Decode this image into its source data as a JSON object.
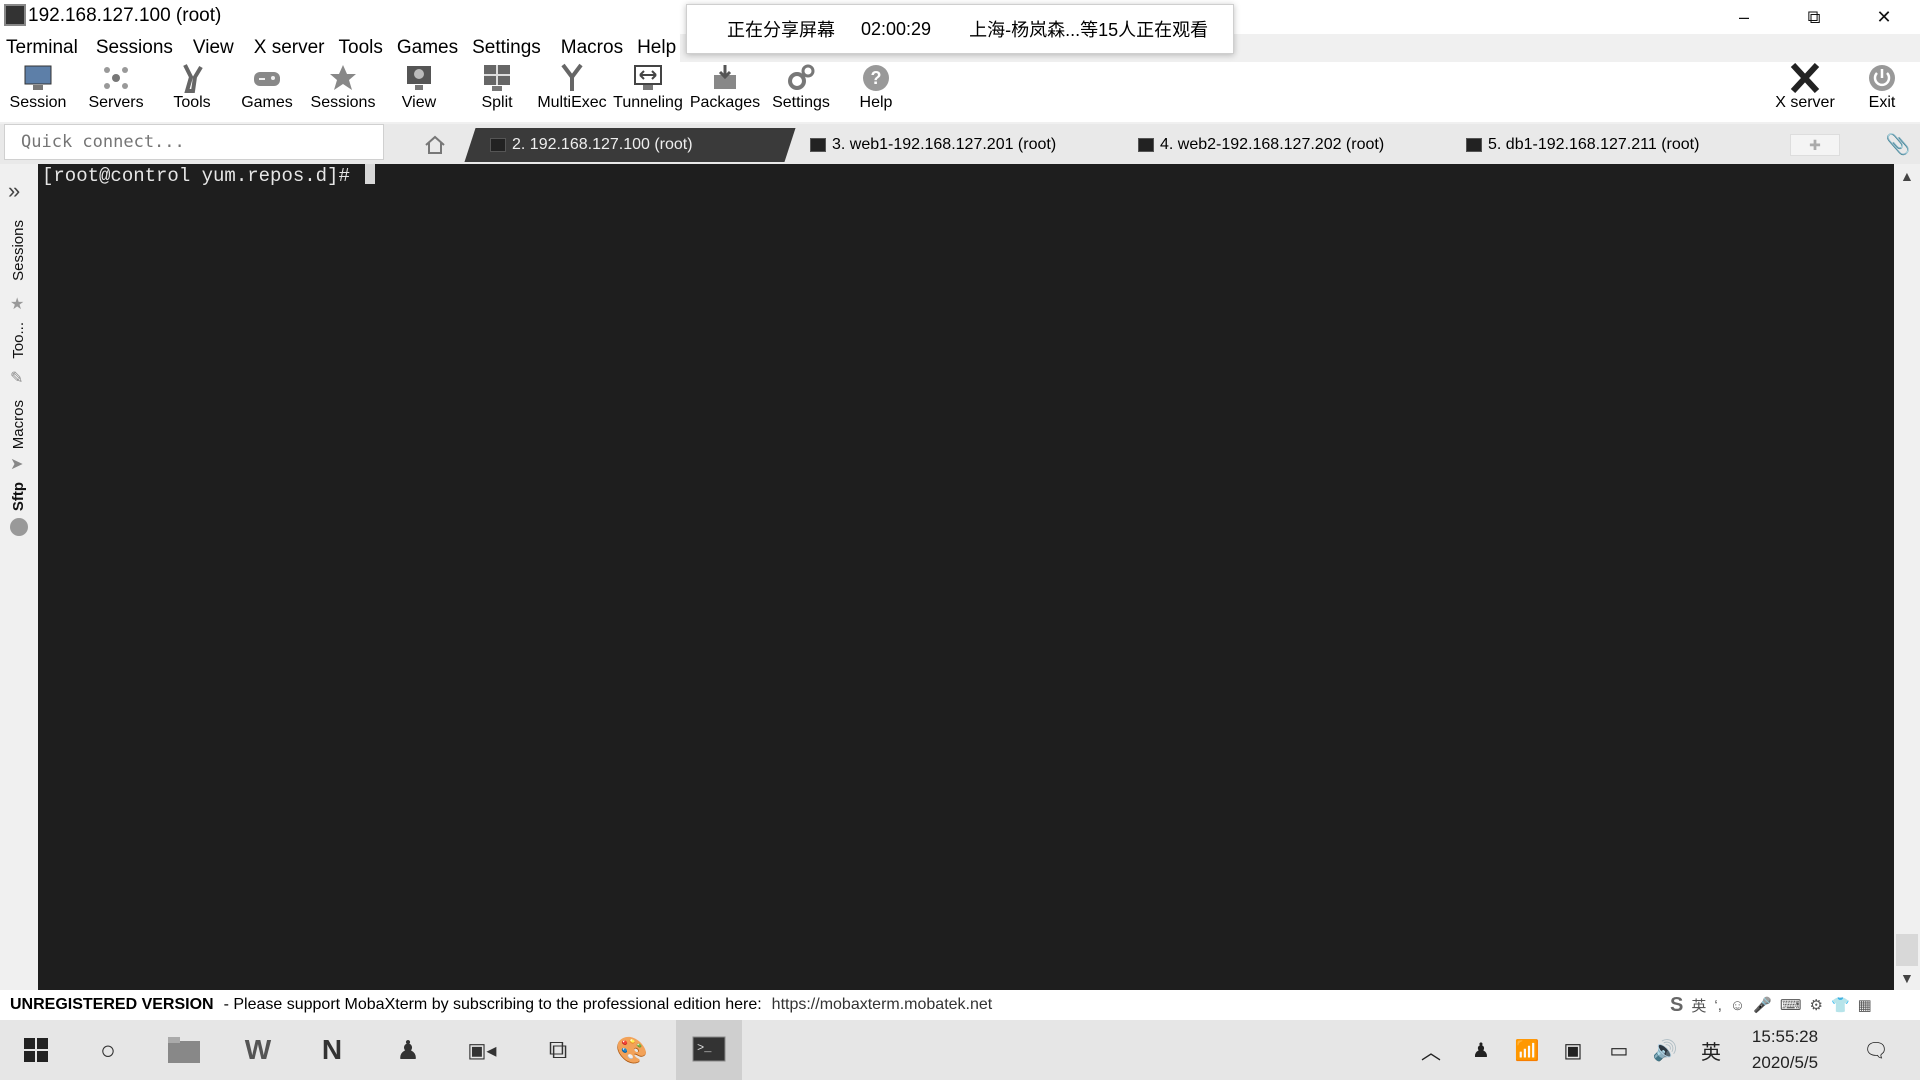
{
  "window": {
    "title": "192.168.127.100 (root)",
    "minimize": "–",
    "restore": "⧉",
    "close": "✕"
  },
  "menu": [
    "Terminal",
    "Sessions",
    "View",
    "X server",
    "Tools",
    "Games",
    "Settings",
    "Macros",
    "Help"
  ],
  "toolbar": {
    "session": "Session",
    "servers": "Servers",
    "tools": "Tools",
    "games": "Games",
    "sessions": "Sessions",
    "view": "View",
    "split": "Split",
    "multiexec": "MultiExec",
    "tunneling": "Tunneling",
    "packages": "Packages",
    "settings": "Settings",
    "help": "Help",
    "xserver": "X server",
    "exit": "Exit"
  },
  "share": {
    "status": "正在分享屏幕",
    "elapsed": "02:00:29",
    "viewers": "上海-杨岚森...等15人正在观看"
  },
  "quick_connect": {
    "placeholder": "Quick connect..."
  },
  "tabs": [
    {
      "label": "2. 192.168.127.100 (root)"
    },
    {
      "label": "3. web1-192.168.127.201 (root)"
    },
    {
      "label": "4. web2-192.168.127.202 (root)"
    },
    {
      "label": "5. db1-192.168.127.211 (root)"
    }
  ],
  "sidebar": {
    "sessions": "Sessions",
    "tools": "Too...",
    "macros": "Macros",
    "sftp": "Sftp"
  },
  "terminal": {
    "prompt": "[root@control yum.repos.d]# "
  },
  "status": {
    "unregistered": "UNREGISTERED VERSION",
    "message": "-  Please support MobaXterm by subscribing to the professional edition here:",
    "link": "https://mobaxterm.mobatek.net"
  },
  "ime": {
    "lang": "英"
  },
  "taskbar": {
    "lang": "英",
    "time": "15:55:28",
    "date": "2020/5/5"
  }
}
